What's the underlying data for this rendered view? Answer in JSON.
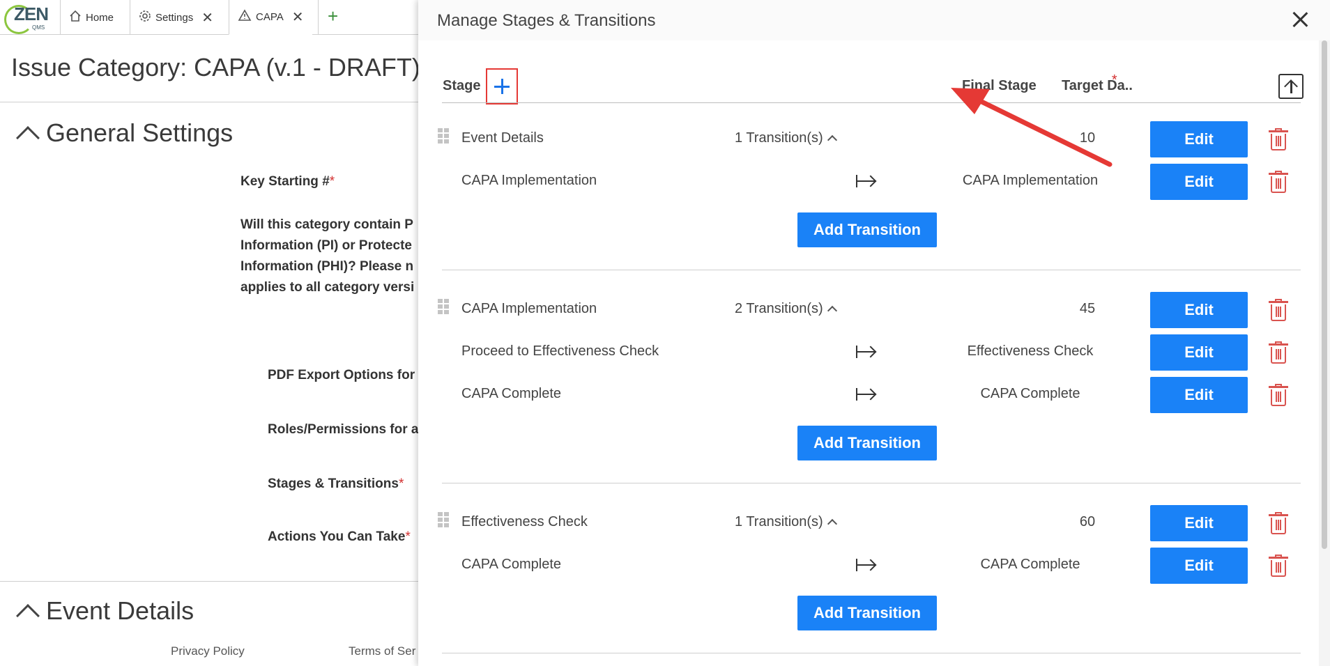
{
  "app": {
    "logo_text": "ZEN",
    "logo_sub": "QMS",
    "tabs": [
      {
        "label": "Home",
        "icon": "home-icon"
      },
      {
        "label": "Settings",
        "icon": "gear-icon"
      },
      {
        "label": "CAPA",
        "icon": "warning-icon"
      }
    ],
    "new_tab_icon": "plus-icon"
  },
  "page": {
    "title": "Issue Category: CAPA (v.1 - DRAFT)",
    "general_settings": "General Settings",
    "key_starting": "Key Starting #",
    "pi_question": [
      "Will this category contain P",
      "Information (PI) or Protecte",
      "Information (PHI)? Please n",
      "applies to all category versi"
    ],
    "pdf_export": "PDF Export Options for",
    "roles": "Roles/Permissions for a",
    "stages_transitions": "Stages & Transitions",
    "actions": "Actions You Can Take",
    "event_details": "Event Details",
    "footer": {
      "privacy": "Privacy Policy",
      "terms": "Terms of Ser"
    },
    "required_mark": "*"
  },
  "modal": {
    "title": "Manage Stages & Transitions",
    "columns": {
      "stage": "Stage",
      "final_stage": "Final Stage",
      "target_days": "Target Da.."
    },
    "edit_label": "Edit",
    "add_transition_label": "Add Transition",
    "stages": [
      {
        "name": "Event Details",
        "transitions_label": "1 Transition(s)",
        "target_days": "10",
        "transitions": [
          {
            "name": "CAPA Implementation",
            "final": "CAPA Implementation"
          }
        ]
      },
      {
        "name": "CAPA Implementation",
        "transitions_label": "2 Transition(s)",
        "target_days": "45",
        "transitions": [
          {
            "name": "Proceed to Effectiveness Check",
            "final": "Effectiveness Check"
          },
          {
            "name": "CAPA Complete",
            "final": "CAPA Complete"
          }
        ]
      },
      {
        "name": "Effectiveness Check",
        "transitions_label": "1 Transition(s)",
        "target_days": "60",
        "transitions": [
          {
            "name": "CAPA Complete",
            "final": "CAPA Complete"
          }
        ]
      }
    ]
  },
  "colors": {
    "primary": "#1a82f7",
    "danger": "#d9534f",
    "annotation": "#e53935"
  }
}
